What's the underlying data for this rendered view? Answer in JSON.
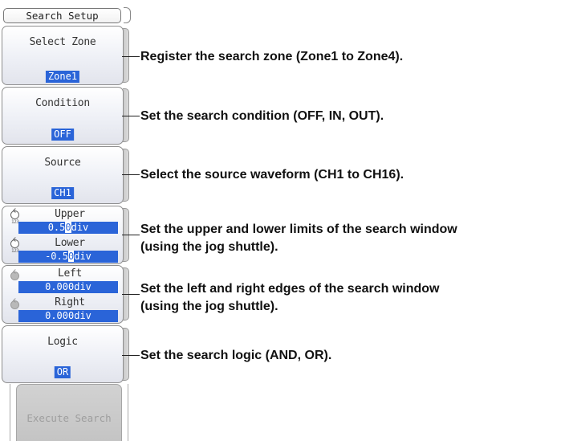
{
  "menu": {
    "title": "Search Setup",
    "keys": {
      "zone": {
        "label": "Select Zone",
        "value": "Zone1"
      },
      "condition": {
        "label": "Condition",
        "value": "OFF"
      },
      "source": {
        "label": "Source",
        "value": "CH1"
      },
      "upper": {
        "label": "Upper",
        "value_a": "0.5",
        "value_cursor": "0",
        "value_b": "div"
      },
      "lower": {
        "label": "Lower",
        "value_a": "-0.5",
        "value_cursor": "0",
        "value_b": "div"
      },
      "left": {
        "label": "Left",
        "value": "0.000div"
      },
      "right": {
        "label": "Right",
        "value": "0.000div"
      },
      "logic": {
        "label": "Logic",
        "value": "OR"
      },
      "execute": {
        "label": "Execute Search",
        "enabled": false
      }
    },
    "jog_icon_text": "123",
    "colors": {
      "selected_bg": "#2a64d8",
      "disabled": "#c4c4c4"
    }
  },
  "callouts": {
    "zone": "Register the search zone (Zone1 to Zone4).",
    "condition": "Set the search condition (OFF, IN, OUT).",
    "source": "Select the source waveform (CH1 to CH16).",
    "window_1": "Set the upper and lower limits of the search window",
    "window_2": "(using the jog shuttle).",
    "edges_1": "Set the left and right edges of the search window",
    "edges_2": "(using the jog shuttle).",
    "logic": "Set the search logic (AND, OR)."
  }
}
